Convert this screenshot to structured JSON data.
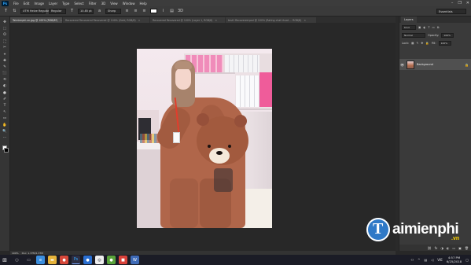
{
  "app": {
    "logo": "Ps"
  },
  "menu": [
    "File",
    "Edit",
    "Image",
    "Layer",
    "Type",
    "Select",
    "Filter",
    "3D",
    "View",
    "Window",
    "Help"
  ],
  "window_controls": [
    "–",
    "❐",
    "✕"
  ],
  "options_bar": {
    "font_family": "UTM Helve Regular",
    "font_style": "Regular",
    "font_size": "10.85 pt",
    "antialias": "Sharp",
    "workspace": "Essentials"
  },
  "tabs": [
    {
      "label": "Taimienphi.vn.jpg @ 100% (RGB/8*)",
      "active": true
    },
    {
      "label": "Recovered Recovered Recovered @ 100% (Gold, RGB/8)",
      "active": false
    },
    {
      "label": "Recovered Recovered @ 100% (Layer 1, RGB/8)",
      "active": false
    },
    {
      "label": "test1 Recovered.psd @ 100% (Rating chat thuat ... RGB/8)",
      "active": false
    }
  ],
  "tools": [
    "✥",
    "⬚",
    "ʘ",
    "⛶",
    "✂",
    "⌖",
    "✚",
    "✎",
    "⬛",
    "⟲",
    "◐",
    "●",
    "✐",
    "T",
    "↖",
    "▭",
    "✋",
    "🔍",
    "⋯"
  ],
  "panel": {
    "tab_label": "Layers",
    "kind_label": "Kind",
    "blend_mode": "Normal",
    "opacity_label": "Opacity:",
    "opacity_value": "100%",
    "lock_label": "Lock:",
    "fill_label": "Fill:",
    "fill_value": "100%",
    "layer_name": "Background",
    "footer_icons": [
      "⛓",
      "fx",
      "◑",
      "◐",
      "▭",
      "▣",
      "🗑"
    ]
  },
  "status": {
    "zoom": "100%",
    "doc": "Doc: 1.37M/1.37M"
  },
  "watermark": {
    "text": "aimienphi",
    "logo_letter": "T",
    "suffix": ".vn"
  },
  "taskbar": {
    "tray_text": "VIE",
    "time": "4:57 PM",
    "date": "6/25/2018"
  }
}
